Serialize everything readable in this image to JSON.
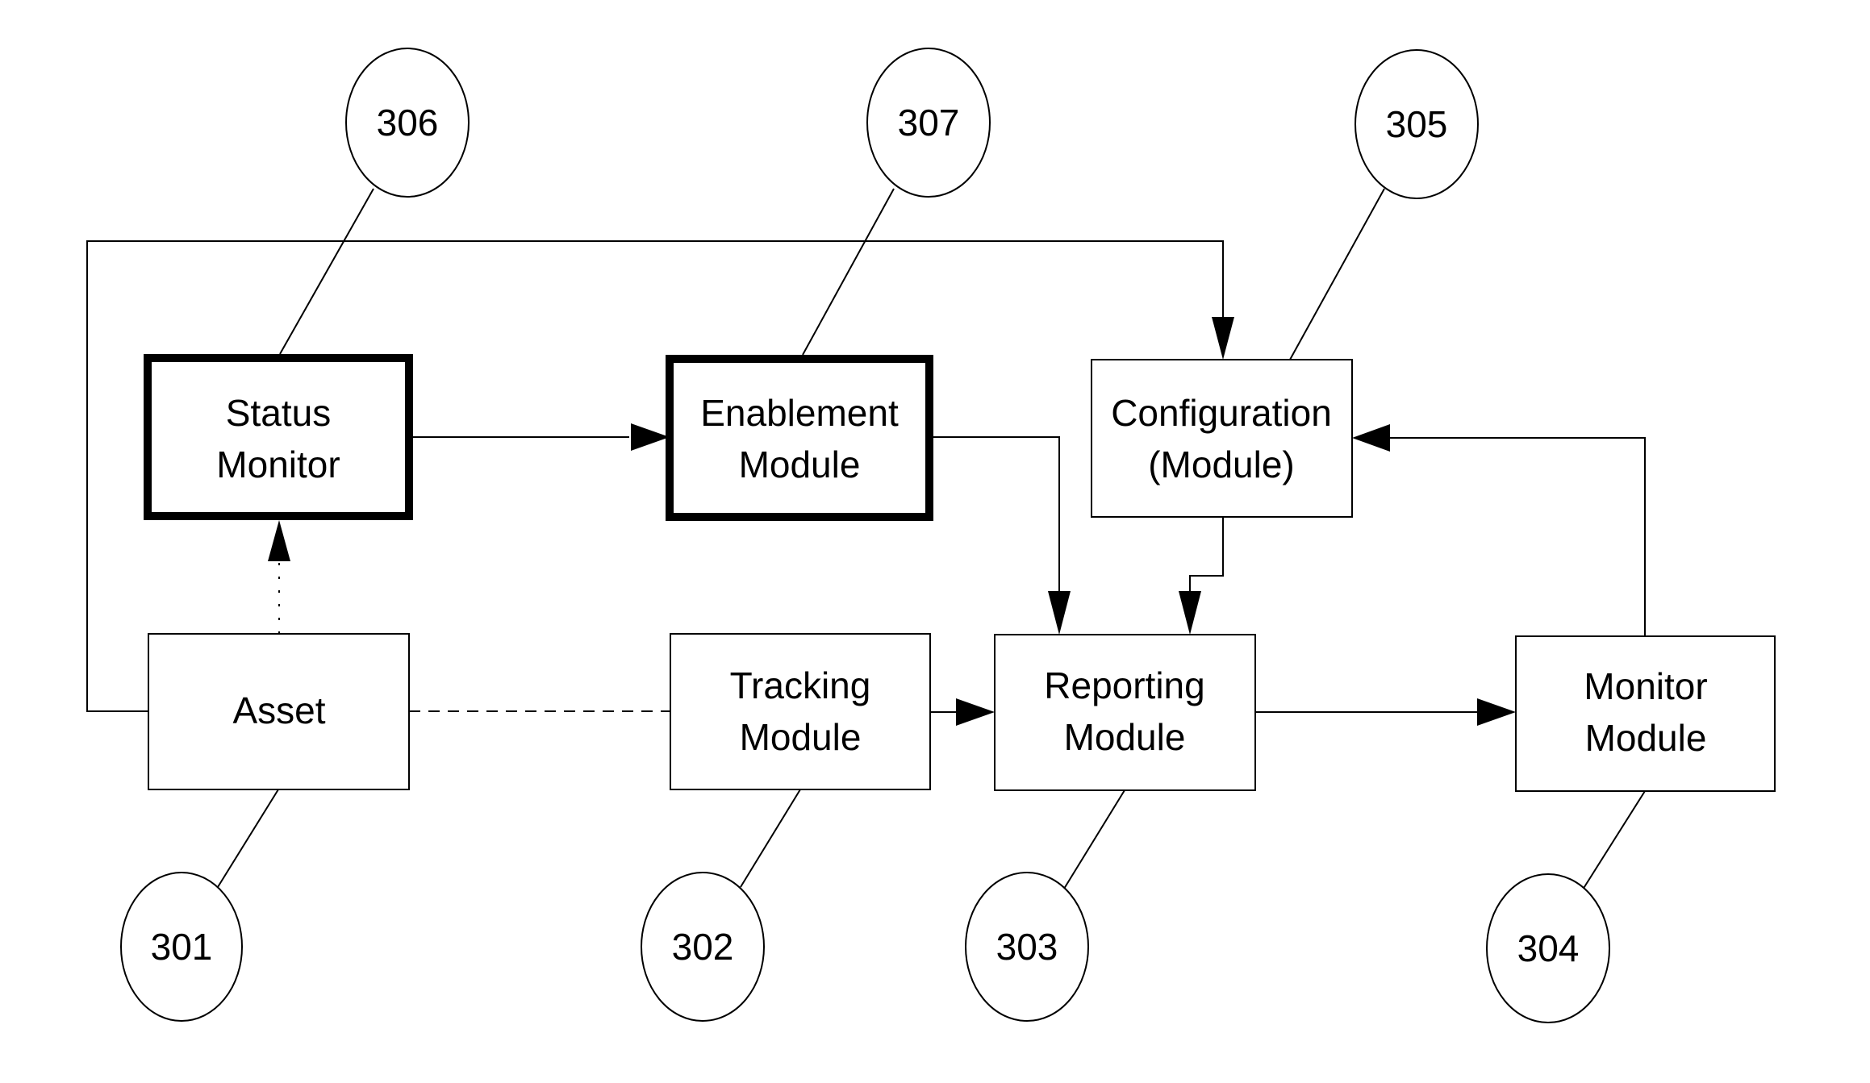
{
  "diagram": {
    "modules": [
      {
        "id": "status-monitor",
        "lines": [
          "Status",
          "Monitor"
        ],
        "emphasis": true,
        "ref": "306"
      },
      {
        "id": "enablement-module",
        "lines": [
          "Enablement",
          "Module"
        ],
        "emphasis": true,
        "ref": "307"
      },
      {
        "id": "configuration-module",
        "lines": [
          "Configuration",
          "(Module)"
        ],
        "emphasis": false,
        "ref": "305"
      },
      {
        "id": "asset",
        "lines": [
          "Asset"
        ],
        "emphasis": false,
        "ref": "301"
      },
      {
        "id": "tracking-module",
        "lines": [
          "Tracking",
          "Module"
        ],
        "emphasis": false,
        "ref": "302"
      },
      {
        "id": "reporting-module",
        "lines": [
          "Reporting",
          "Module"
        ],
        "emphasis": false,
        "ref": "303"
      },
      {
        "id": "monitor-module",
        "lines": [
          "Monitor",
          "Module"
        ],
        "emphasis": false,
        "ref": "304"
      }
    ],
    "reference_numerals": [
      "306",
      "307",
      "305",
      "301",
      "302",
      "303",
      "304"
    ],
    "connections": [
      {
        "from": "asset",
        "to": "configuration-module",
        "style": "solid"
      },
      {
        "from": "asset",
        "to": "status-monitor",
        "style": "dotted"
      },
      {
        "from": "asset",
        "to": "tracking-module",
        "style": "dashed"
      },
      {
        "from": "status-monitor",
        "to": "enablement-module",
        "style": "solid"
      },
      {
        "from": "enablement-module",
        "to": "reporting-module",
        "style": "solid"
      },
      {
        "from": "configuration-module",
        "to": "reporting-module",
        "style": "solid"
      },
      {
        "from": "tracking-module",
        "to": "reporting-module",
        "style": "solid"
      },
      {
        "from": "reporting-module",
        "to": "monitor-module",
        "style": "solid"
      },
      {
        "from": "monitor-module",
        "to": "configuration-module",
        "style": "solid"
      }
    ]
  }
}
